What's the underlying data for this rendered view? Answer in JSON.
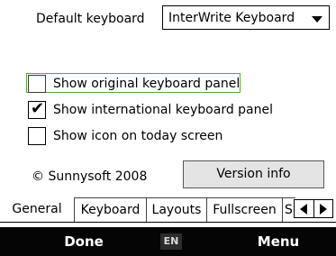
{
  "keyboard_setting": {
    "label": "Default keyboard",
    "selected": "InterWrite Keyboard"
  },
  "options": [
    {
      "label": "Show original keyboard panel",
      "checked": false,
      "focused": true
    },
    {
      "label": "Show international keyboard panel",
      "checked": true,
      "focused": false
    },
    {
      "label": "Show icon on today screen",
      "checked": false,
      "focused": false
    }
  ],
  "check_mark": "✔",
  "copyright": "© Sunnysoft 2008",
  "version_button": "Version info",
  "tabs": {
    "items": [
      "General",
      "Keyboard",
      "Layouts",
      "Fullscreen",
      "S"
    ],
    "active": "General"
  },
  "softkeys": {
    "left": "Done",
    "right": "Menu",
    "input_indicator": "EN"
  },
  "colors": {
    "focus_border": "#62a23c",
    "softkey_bar": "#050505",
    "button_face": "#e4e4e4"
  }
}
